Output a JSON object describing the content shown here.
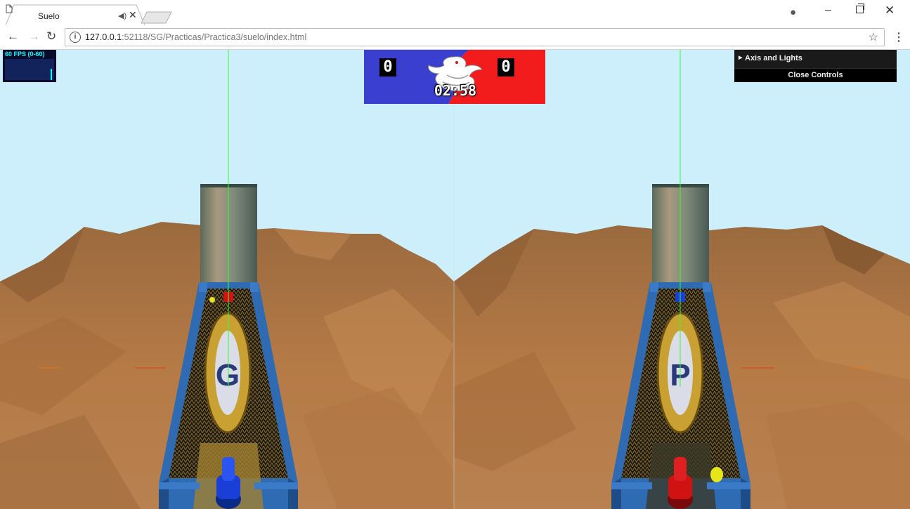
{
  "browser": {
    "tab_title": "Suelo",
    "tab_audio_icon": "speaker-icon",
    "url_host": "127.0.0.1",
    "url_rest": ":52118/SG/Practicas/Practica3/suelo/index.html",
    "profile_icon": "account-icon"
  },
  "stats": {
    "label": "60 FPS (0-60)"
  },
  "scoreboard": {
    "blue_score": "0",
    "red_score": "0",
    "timer": "02:58",
    "blue_color": "#3b3fcf",
    "red_color": "#f21c1c"
  },
  "gui": {
    "folder_label": "Axis and Lights",
    "close_label": "Close Controls"
  },
  "scene": {
    "sky_color": "#cdeefb",
    "terrain_color": "#a86b3a",
    "table_frame_color": "#2e6bb3",
    "left_view_puck_color": "#1a3fd6",
    "right_view_puck_color": "#d01212",
    "ball_color": "#e6e61a"
  }
}
